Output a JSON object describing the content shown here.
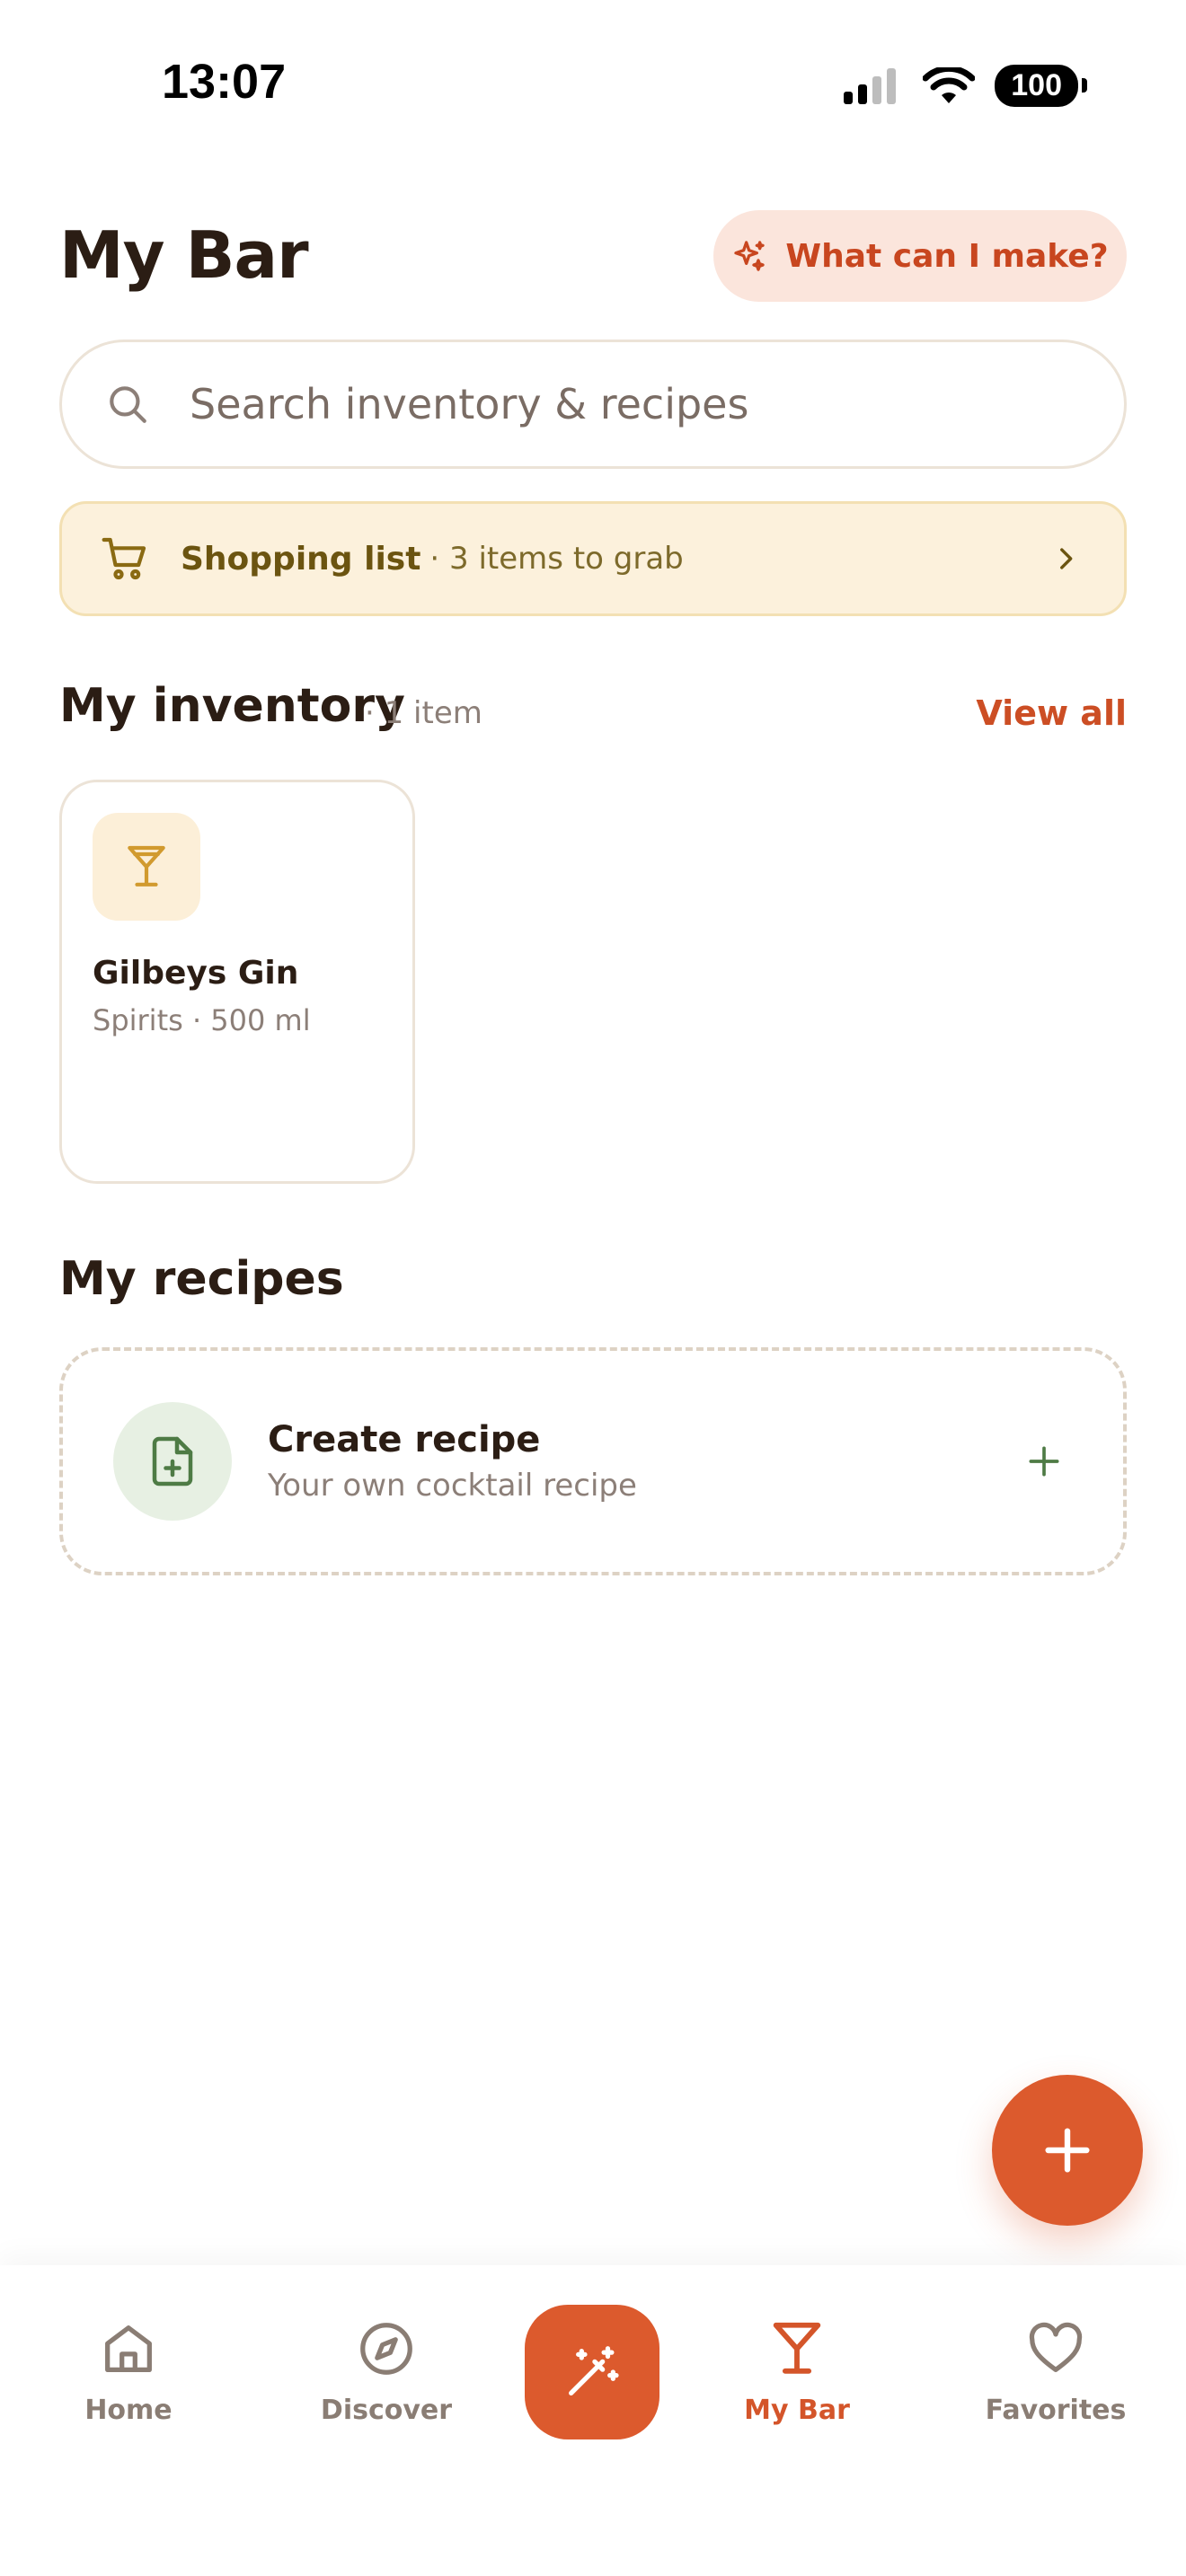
{
  "status_bar": {
    "time": "13:07",
    "battery": "100"
  },
  "header": {
    "title": "My Bar",
    "make_button": "What can I make?"
  },
  "search": {
    "placeholder": "Search inventory & recipes"
  },
  "shopping": {
    "label": "Shopping list",
    "summary": "· 3 items to grab"
  },
  "inventory": {
    "title": "My inventory",
    "count": "· 1 item",
    "view_all": "View all",
    "items": [
      {
        "name": "Gilbeys Gin",
        "meta": "Spirits · 500 ml"
      }
    ]
  },
  "recipes": {
    "title": "My recipes",
    "create": {
      "title": "Create recipe",
      "subtitle": "Your own cocktail recipe"
    }
  },
  "nav": {
    "items": [
      {
        "label": "Home"
      },
      {
        "label": "Discover"
      },
      {
        "label": "My Bar"
      },
      {
        "label": "Favorites"
      }
    ],
    "active": "My Bar"
  },
  "colors": {
    "accent": "#dc5a2d",
    "text": "#2b1d14",
    "muted": "#8c7f78"
  }
}
